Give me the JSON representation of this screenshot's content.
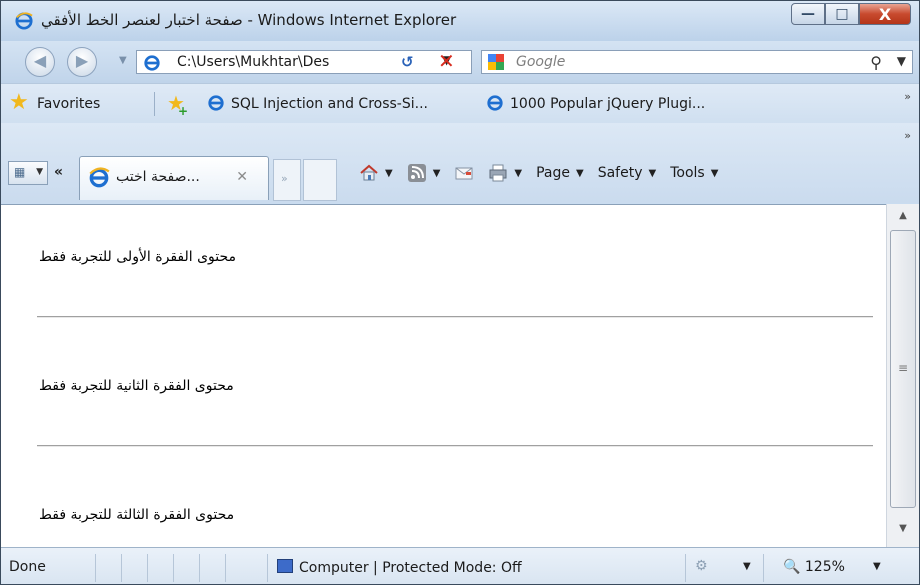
{
  "window": {
    "title": "صفحة اختبار لعنصر الخط الأفقي - Windows Internet Explorer",
    "buttons": {
      "minimize": "—",
      "maximize": "□",
      "close": "X"
    }
  },
  "address_bar": {
    "url": "C:\\Users\\Mukhtar\\Des",
    "search_placeholder": "Google"
  },
  "favorites_bar": {
    "favorites_label": "Favorites",
    "items": [
      {
        "label": "SQL Injection and Cross-Si..."
      },
      {
        "label": "1000 Popular jQuery Plugi..."
      }
    ]
  },
  "tabs": {
    "active_tab_label": "...صفحة اختب"
  },
  "command_bar": {
    "page_label": "Page",
    "safety_label": "Safety",
    "tools_label": "Tools"
  },
  "content": {
    "paragraphs": [
      "محتوى الفقرة الأولى للتجربة فقط",
      "محتوى الفقرة الثانية للتجربة فقط",
      "محتوى الفقرة الثالثة للتجربة فقط"
    ]
  },
  "status_bar": {
    "status_text": "Done",
    "zone_text": "Computer | Protected Mode: Off",
    "zoom": "125%"
  },
  "colors": {
    "ie_blue": "#1e6fd0",
    "stop_red": "#d72b1e",
    "star_gold": "#f1b81d"
  },
  "icons": [
    "ie-icon",
    "back-icon",
    "forward-icon",
    "refresh-icon",
    "stop-icon",
    "google-icon",
    "search-icon",
    "favorites-star-icon",
    "add-favorite-icon",
    "quick-tabs-icon",
    "home-icon",
    "rss-icon",
    "mail-icon",
    "print-icon",
    "computer-zone-icon",
    "protected-mode-icon",
    "zoom-icon"
  ]
}
